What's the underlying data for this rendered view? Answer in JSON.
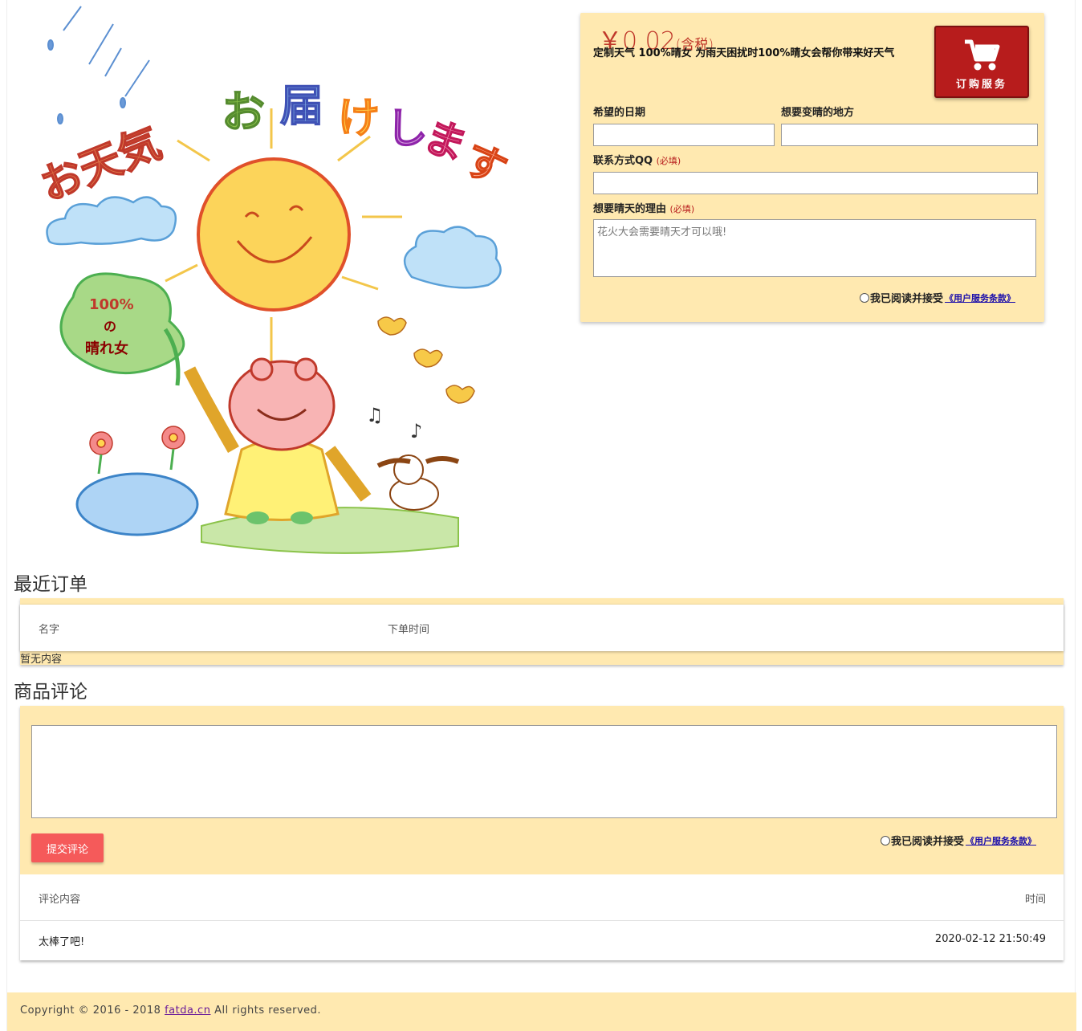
{
  "product": {
    "price": "￥0.02",
    "tax_note": "(含税)",
    "description": "定制天气 100%晴女 为雨天困扰时100%晴女会帮你带来好天气",
    "buy_label": "订购服务",
    "illustration_text": {
      "headline": "お天気お届けします",
      "leaf": "100%の晴れ女"
    }
  },
  "order_form": {
    "date_label": "希望的日期",
    "date_value": "",
    "place_label": "想要变晴的地方",
    "place_value": "",
    "qq_label": "联系方式QQ",
    "required": "(必填)",
    "qq_value": "",
    "reason_label": "想要晴天的理由",
    "reason_placeholder": "花火大会需要晴天才可以哦!",
    "agree_text": "我已阅读并接受",
    "terms_link": "《用户服务条款》"
  },
  "recent_orders": {
    "title": "最近订单",
    "columns": [
      "名字",
      "下单时间"
    ],
    "rows": [],
    "empty_text": "暂无内容"
  },
  "reviews": {
    "title": "商品评论",
    "input_value": "",
    "submit_label": "提交评论",
    "agree_text": "我已阅读并接受",
    "terms_link": "《用户服务条款》",
    "columns": [
      "评论内容",
      "时间"
    ],
    "rows": [
      {
        "content": "太棒了吧!",
        "time": "2020-02-12 21:50:49"
      }
    ]
  },
  "footer": {
    "prefix": "Copyright © 2016 - 2018",
    "link": "fatda.cn",
    "suffix": "All rights reserved."
  }
}
